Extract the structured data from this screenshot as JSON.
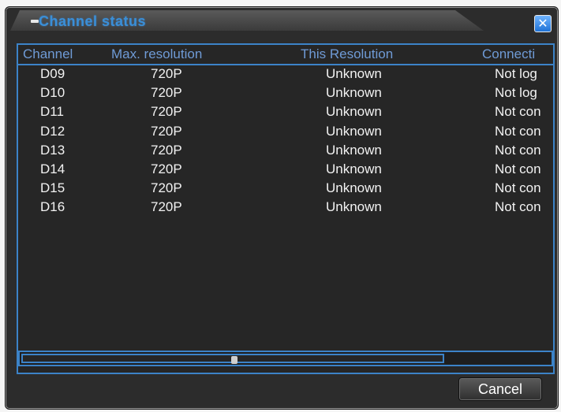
{
  "window": {
    "title": "Channel status",
    "close_icon": "close-icon",
    "accent_color": "#3c83c8"
  },
  "table": {
    "headers": [
      "Channel",
      "Max. resolution",
      "This Resolution",
      "Connecti"
    ],
    "rows": [
      {
        "channel": "D09",
        "max": "720P",
        "this": "Unknown",
        "conn": "Not log"
      },
      {
        "channel": "D10",
        "max": "720P",
        "this": "Unknown",
        "conn": "Not log"
      },
      {
        "channel": "D11",
        "max": "720P",
        "this": "Unknown",
        "conn": "Not con"
      },
      {
        "channel": "D12",
        "max": "720P",
        "this": "Unknown",
        "conn": "Not con"
      },
      {
        "channel": "D13",
        "max": "720P",
        "this": "Unknown",
        "conn": "Not con"
      },
      {
        "channel": "D14",
        "max": "720P",
        "this": "Unknown",
        "conn": "Not con"
      },
      {
        "channel": "D15",
        "max": "720P",
        "this": "Unknown",
        "conn": "Not con"
      },
      {
        "channel": "D16",
        "max": "720P",
        "this": "Unknown",
        "conn": "Not con"
      }
    ]
  },
  "footer": {
    "cancel_label": "Cancel"
  }
}
